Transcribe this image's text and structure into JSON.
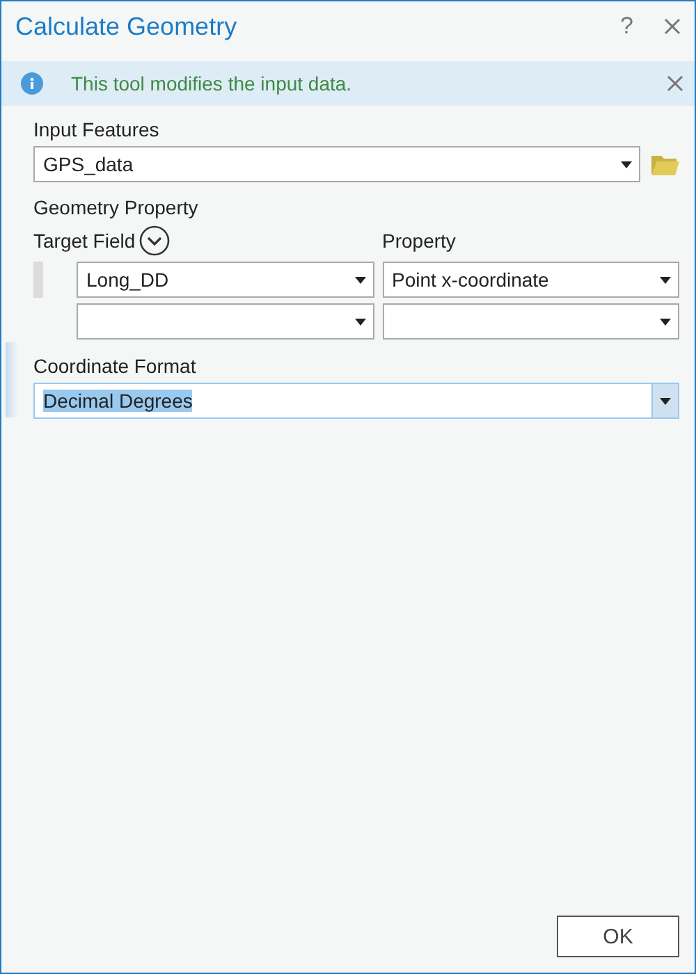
{
  "window": {
    "title": "Calculate Geometry",
    "help": "?"
  },
  "banner": {
    "message": "This tool modifies the input data."
  },
  "input_features": {
    "label": "Input Features",
    "value": "GPS_data"
  },
  "geometry_property": {
    "label": "Geometry Property",
    "columns": [
      "Target Field",
      "Property"
    ],
    "rows": [
      {
        "target_field": "Long_DD",
        "property": "Point x-coordinate"
      },
      {
        "target_field": "",
        "property": ""
      }
    ]
  },
  "coordinate_format": {
    "label": "Coordinate Format",
    "value": "Decimal Degrees",
    "focused": true
  },
  "buttons": [
    "OK"
  ]
}
